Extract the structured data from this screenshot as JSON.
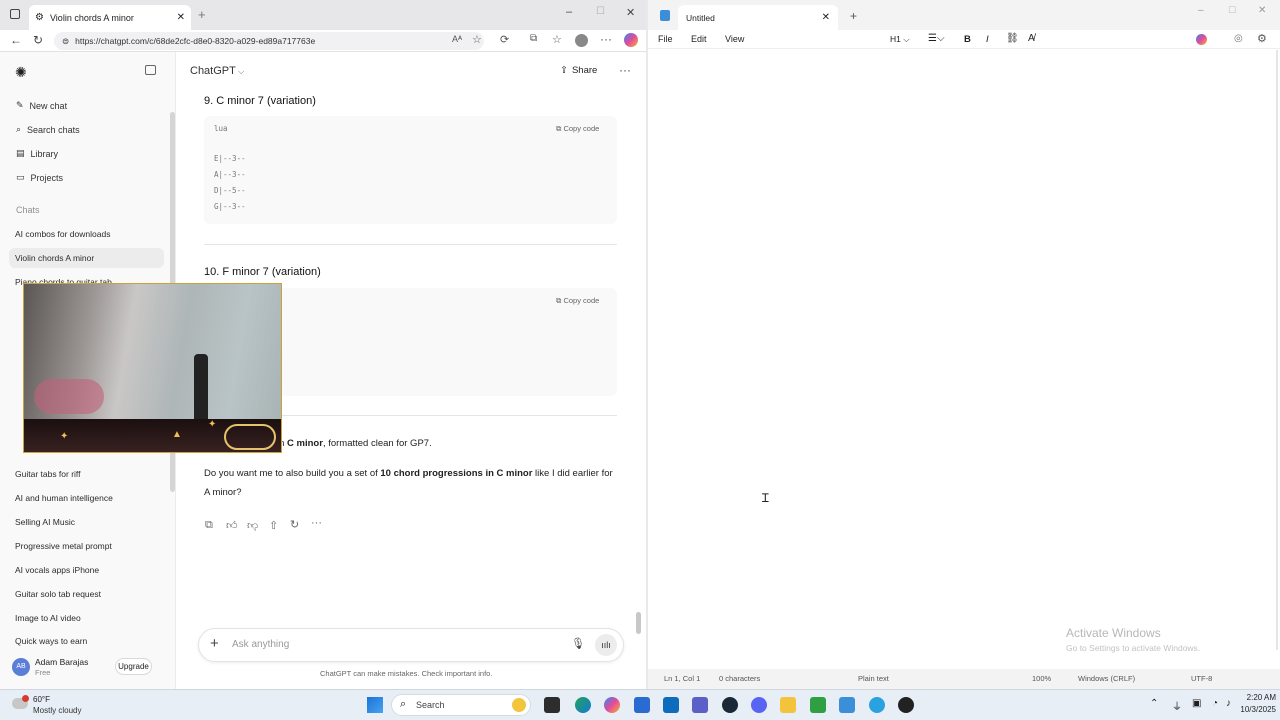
{
  "browser": {
    "tab_title": "Violin chords A minor",
    "url": "https://chatgpt.com/c/68de2cfc-d8e0-8320-a029-ed89a717763e"
  },
  "sidebar": {
    "nav": [
      {
        "label": "New chat",
        "icon": "pencil-icon"
      },
      {
        "label": "Search chats",
        "icon": "search-icon"
      },
      {
        "label": "Library",
        "icon": "library-icon"
      },
      {
        "label": "Projects",
        "icon": "folder-icon"
      }
    ],
    "section": "Chats",
    "chats": [
      "AI combos for downloads",
      "Violin chords A minor",
      "Piano chords to guitar tab",
      "Guitar tabs for riff",
      "AI and human intelligence",
      "Selling AI Music",
      "Progressive metal prompt",
      "AI vocals apps iPhone",
      "Guitar solo tab request",
      "Image to AI video",
      "Quick ways to earn"
    ],
    "user_name": "Adam Barajas",
    "user_plan": "Free",
    "user_initials": "AB",
    "upgrade": "Upgrade"
  },
  "main": {
    "model": "ChatGPT",
    "share": "Share",
    "h9": "9. C minor 7 (variation)",
    "code9_lang": "lua",
    "copy": "Copy code",
    "code9_lines": [
      "E|--3--",
      "A|--3--",
      "D|--5--",
      "G|--3--"
    ],
    "h10": "10. F minor 7 (variation)",
    "summary_bold": "C minor",
    "summary_rest": ", formatted clean for GP7.",
    "summary_prefix": "in",
    "question_a": "Do you want me to also build you a set of ",
    "question_bold": "10 chord progressions in C minor",
    "question_b": " like I did earlier for A minor?",
    "placeholder": "Ask anything",
    "disclaimer": "ChatGPT can make mistakes. Check important info."
  },
  "notepad": {
    "tab_title": "Untitled",
    "menu": [
      "File",
      "Edit",
      "View"
    ],
    "heading_btn": "H1",
    "status": {
      "position": "Ln 1, Col 1",
      "chars": "0 characters",
      "mode": "Plain text",
      "zoom": "100%",
      "eol": "Windows (CRLF)",
      "encoding": "UTF-8"
    },
    "activate_title": "Activate Windows",
    "activate_sub": "Go to Settings to activate Windows."
  },
  "taskbar": {
    "temp": "60°F",
    "weather": "Mostly cloudy",
    "search": "Search",
    "time": "2:20 AM",
    "date": "10/3/2025"
  }
}
